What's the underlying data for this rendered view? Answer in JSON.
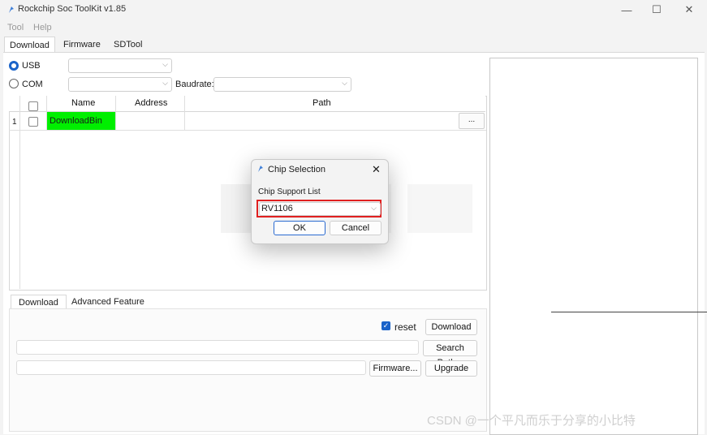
{
  "window": {
    "title": "Rockchip Soc ToolKit v1.85",
    "controls": {
      "minimize": "—",
      "maximize": "☐",
      "close": "✕"
    }
  },
  "menu": {
    "items": [
      "Tool",
      "Help"
    ]
  },
  "tabs": [
    "Download",
    "Firmware",
    "SDTool"
  ],
  "connection": {
    "usb_label": "USB",
    "com_label": "COM",
    "baudrate_label": "Baudrate:",
    "usb_selected": true
  },
  "table": {
    "headers": {
      "name": "Name",
      "address": "Address",
      "path": "Path"
    },
    "rows": [
      {
        "index": "1",
        "name": "DownloadBin",
        "address": "",
        "path": "",
        "browse_label": "..."
      }
    ]
  },
  "bottom": {
    "tabs": [
      "Download",
      "Advanced Feature"
    ],
    "reset_label": "reset",
    "reset_checked": true,
    "download_button": "Download",
    "search_path_button": "Search Path...",
    "firmware_button": "Firmware...",
    "upgrade_button": "Upgrade"
  },
  "dialog": {
    "title": "Chip Selection",
    "close": "✕",
    "list_label": "Chip Support List",
    "selected_chip": "RV1106",
    "ok_label": "OK",
    "cancel_label": "Cancel",
    "highlight_color": "#e02020"
  },
  "watermark_text": "CSDN @一个平凡而乐于分享的小比特",
  "colors": {
    "accent": "#1a63c9",
    "cell_highlight": "#00ef00"
  }
}
